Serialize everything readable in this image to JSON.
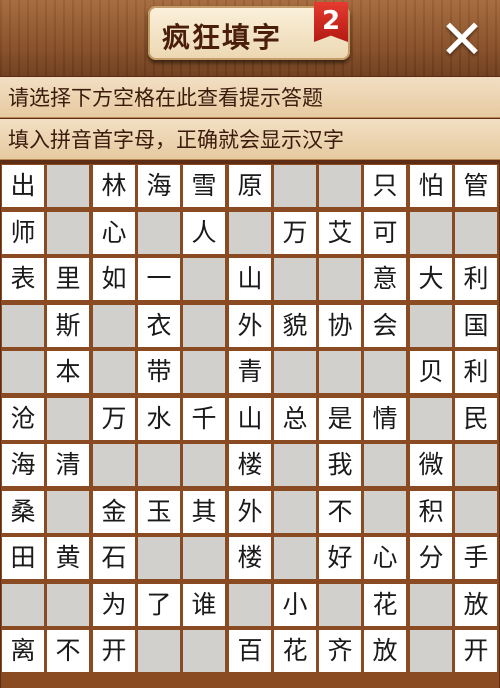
{
  "header": {
    "title": "疯狂填字",
    "level_badge": "2",
    "close_symbol": "✕"
  },
  "hints": [
    "请选择下方空格在此查看提示答题",
    "填入拼音首字母，正确就会显示汉字"
  ],
  "colors": {
    "board_frame": "#8a4a22",
    "letter_cell": "#ffffff",
    "blocked_cell": "#d2d0cd",
    "badge": "#d62b22"
  },
  "grid": {
    "columns": 11,
    "rows": 11,
    "cells": [
      [
        "出",
        "",
        "林",
        "海",
        "雪",
        "原",
        "",
        "",
        "只",
        "怕",
        "管"
      ],
      [
        "师",
        "",
        "心",
        "",
        "人",
        "",
        "万",
        "艾",
        "可",
        "",
        ""
      ],
      [
        "表",
        "里",
        "如",
        "一",
        "",
        "山",
        "",
        "",
        "意",
        "大",
        "利"
      ],
      [
        "",
        "斯",
        "",
        "衣",
        "",
        "外",
        "貌",
        "协",
        "会",
        "",
        "国"
      ],
      [
        "",
        "本",
        "",
        "带",
        "",
        "青",
        "",
        "",
        "",
        "贝",
        "利"
      ],
      [
        "沧",
        "",
        "万",
        "水",
        "千",
        "山",
        "总",
        "是",
        "情",
        "",
        "民"
      ],
      [
        "海",
        "清",
        "",
        "",
        "",
        "楼",
        "",
        "我",
        "",
        "微",
        ""
      ],
      [
        "桑",
        "",
        "金",
        "玉",
        "其",
        "外",
        "",
        "不",
        "",
        "积",
        ""
      ],
      [
        "田",
        "黄",
        "石",
        "",
        "",
        "楼",
        "",
        "好",
        "心",
        "分",
        "手"
      ],
      [
        "",
        "",
        "为",
        "了",
        "谁",
        "",
        "小",
        "",
        "花",
        "",
        "放"
      ],
      [
        "离",
        "不",
        "开",
        "",
        "",
        "百",
        "花",
        "齐",
        "放",
        "",
        "开"
      ]
    ]
  }
}
